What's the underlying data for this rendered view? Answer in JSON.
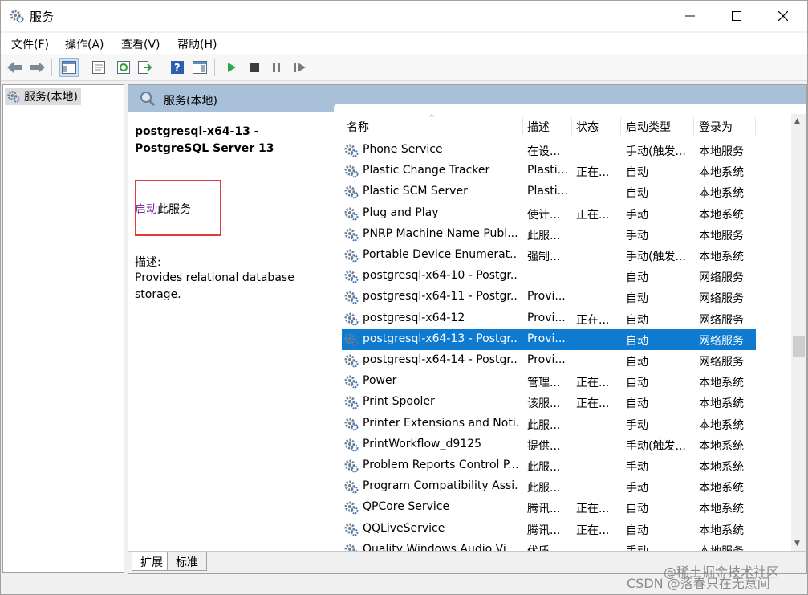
{
  "window": {
    "title": "服务"
  },
  "menu": [
    "文件(F)",
    "操作(A)",
    "查看(V)",
    "帮助(H)"
  ],
  "tree": {
    "root_label": "服务(本地)"
  },
  "main": {
    "header": "服务(本地)",
    "service_title": "postgresql-x64-13 - PostgreSQL Server 13",
    "start_link": "启动",
    "start_suffix": "此服务",
    "desc_label": "描述:",
    "desc_text": "Provides relational database storage."
  },
  "columns": {
    "name": "名称",
    "desc": "描述",
    "status": "状态",
    "start_type": "启动类型",
    "logon": "登录为"
  },
  "rows": [
    {
      "name": "Phone Service",
      "desc": "在设...",
      "status": "",
      "type": "手动(触发...",
      "logon": "本地服务"
    },
    {
      "name": "Plastic Change Tracker",
      "desc": "Plasti...",
      "status": "正在...",
      "type": "自动",
      "logon": "本地系统"
    },
    {
      "name": "Plastic SCM Server",
      "desc": "Plasti...",
      "status": "",
      "type": "自动",
      "logon": "本地系统"
    },
    {
      "name": "Plug and Play",
      "desc": "使计...",
      "status": "正在...",
      "type": "手动",
      "logon": "本地系统"
    },
    {
      "name": "PNRP Machine Name Publ...",
      "desc": "此服...",
      "status": "",
      "type": "手动",
      "logon": "本地服务"
    },
    {
      "name": "Portable Device Enumerat...",
      "desc": "强制...",
      "status": "",
      "type": "手动(触发...",
      "logon": "本地系统"
    },
    {
      "name": "postgresql-x64-10 - Postgr...",
      "desc": "",
      "status": "",
      "type": "自动",
      "logon": "网络服务"
    },
    {
      "name": "postgresql-x64-11 - Postgr...",
      "desc": "Provi...",
      "status": "",
      "type": "自动",
      "logon": "网络服务"
    },
    {
      "name": "postgresql-x64-12",
      "desc": "Provi...",
      "status": "正在...",
      "type": "自动",
      "logon": "网络服务"
    },
    {
      "name": "postgresql-x64-13 - Postgr...",
      "desc": "Provi...",
      "status": "",
      "type": "自动",
      "logon": "网络服务"
    },
    {
      "name": "postgresql-x64-14 - Postgr...",
      "desc": "Provi...",
      "status": "",
      "type": "自动",
      "logon": "网络服务"
    },
    {
      "name": "Power",
      "desc": "管理...",
      "status": "正在...",
      "type": "自动",
      "logon": "本地系统"
    },
    {
      "name": "Print Spooler",
      "desc": "该服...",
      "status": "正在...",
      "type": "自动",
      "logon": "本地系统"
    },
    {
      "name": "Printer Extensions and Noti...",
      "desc": "此服...",
      "status": "",
      "type": "手动",
      "logon": "本地系统"
    },
    {
      "name": "PrintWorkflow_d9125",
      "desc": "提供...",
      "status": "",
      "type": "手动(触发...",
      "logon": "本地系统"
    },
    {
      "name": "Problem Reports Control P...",
      "desc": "此服...",
      "status": "",
      "type": "手动",
      "logon": "本地系统"
    },
    {
      "name": "Program Compatibility Assi...",
      "desc": "此服...",
      "status": "",
      "type": "手动",
      "logon": "本地系统"
    },
    {
      "name": "QPCore Service",
      "desc": "腾讯...",
      "status": "正在...",
      "type": "自动",
      "logon": "本地系统"
    },
    {
      "name": "QQLiveService",
      "desc": "腾讯...",
      "status": "正在...",
      "type": "自动",
      "logon": "本地系统"
    },
    {
      "name": "Quality Windows Audio Vi...",
      "desc": "优质...",
      "status": "",
      "type": "手动",
      "logon": "本地服务"
    }
  ],
  "selected_index": 9,
  "tabs": [
    "扩展",
    "标准"
  ],
  "watermarks": [
    "@稀土掘金技术社区",
    "CSDN @落春只在无意间"
  ],
  "colors": {
    "selection": "#0f7bd0",
    "header": "#a8c0d8",
    "highlight_box": "#e03a3a",
    "link": "#7a2e9a"
  }
}
